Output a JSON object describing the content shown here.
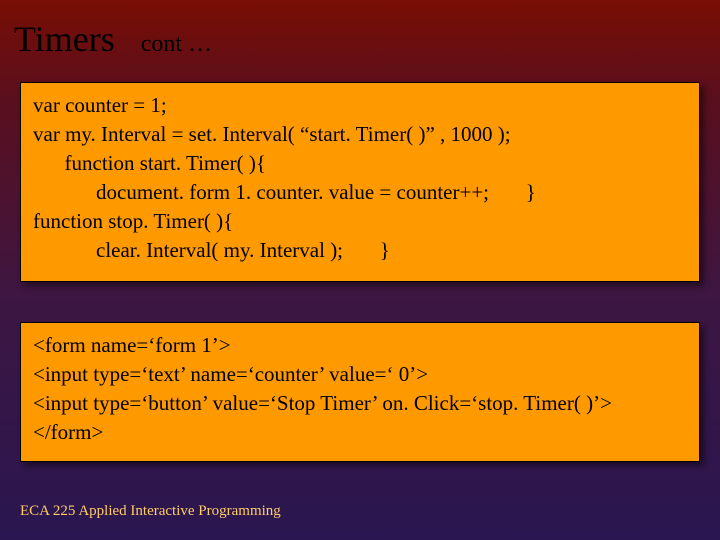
{
  "title": {
    "main": "Timers",
    "sub": "cont …"
  },
  "code1": {
    "l1": "var counter = 1;",
    "l2": "var my. Interval = set. Interval( “start. Timer( )” , 1000 );",
    "l3": "      function start. Timer( ){",
    "l4": "            document. form 1. counter. value = counter++;       }",
    "l5": "function stop. Timer( ){",
    "l6": "            clear. Interval( my. Interval );       }"
  },
  "code2": {
    "l1": "<form name=‘form 1’>",
    "l2": "<input type=‘text’ name=‘counter’ value=‘ 0’>",
    "l3": "<input type=‘button’ value=‘Stop Timer’ on. Click=‘stop. Timer( )’>",
    "l4": "</form>"
  },
  "footer": "ECA 225   Applied Interactive Programming"
}
